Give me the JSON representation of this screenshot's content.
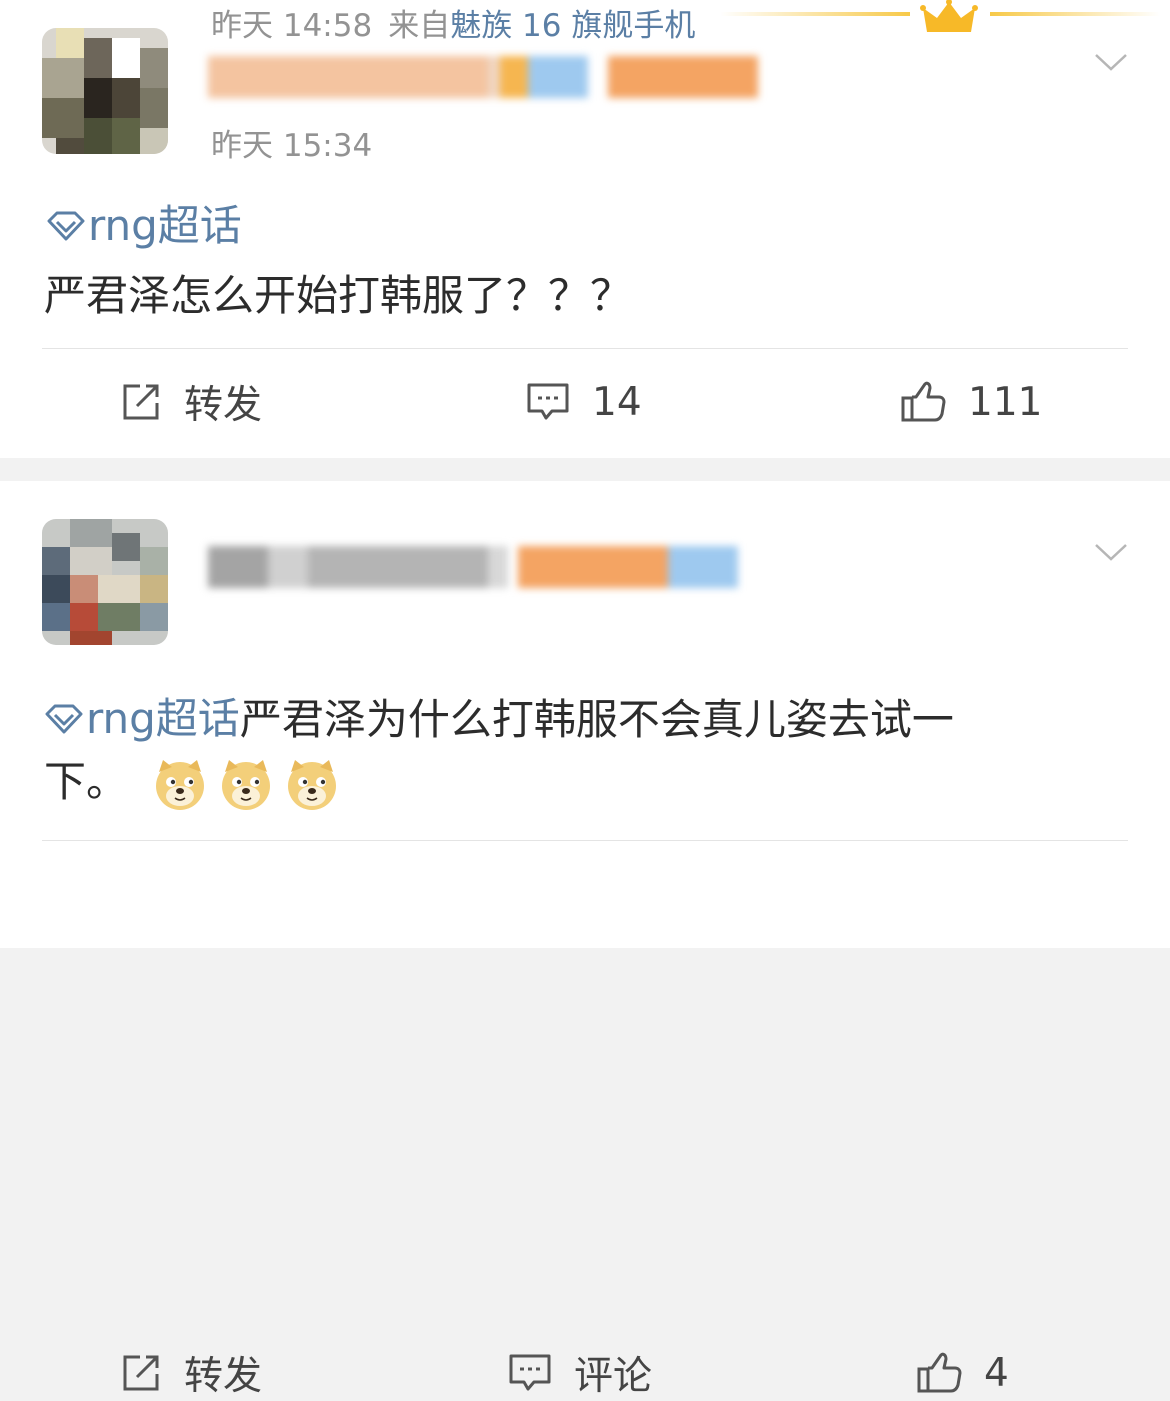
{
  "posts": [
    {
      "timestamp": "昨天 15:34",
      "topic": "rng超话",
      "text": "严君泽怎么开始打韩服了？？？",
      "actions": {
        "repost_label": "转发",
        "comment_label": "14",
        "like_label": "111"
      }
    },
    {
      "timestamp": "昨天 14:58",
      "source_prefix": "来自",
      "source_device": "魅族 16 旗舰手机",
      "topic": "rng超话",
      "text_line1": "严君泽为什么打韩服不会真儿姿去试一",
      "text_line2": "下。",
      "emoji_names": [
        "doge-emoji",
        "doge-emoji",
        "doge-emoji"
      ],
      "actions": {
        "repost_label": "转发",
        "comment_label": "评论",
        "like_label": "4"
      }
    }
  ],
  "icons": {
    "topic": "diamond-icon",
    "menu": "chevron-down-icon",
    "repost": "share-icon",
    "comment": "comment-icon",
    "like": "thumbs-up-icon",
    "decoration": "crown-icon"
  },
  "colors": {
    "link": "#5b7fa5",
    "meta": "#939393",
    "text": "#2c2c2c",
    "separator": "#f2f2f2"
  }
}
